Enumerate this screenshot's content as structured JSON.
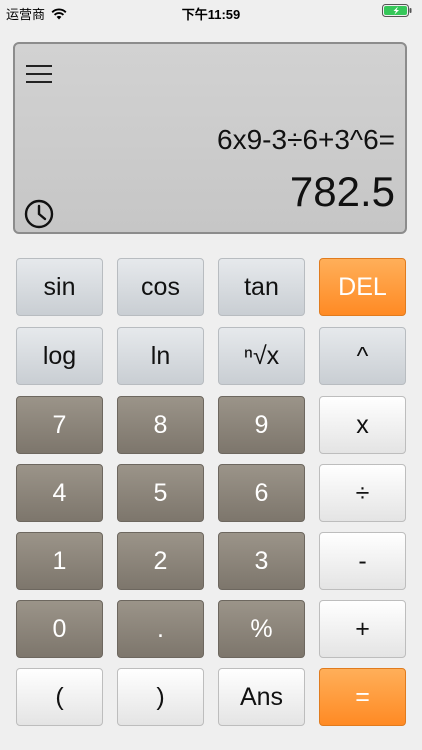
{
  "status_bar": {
    "carrier": "运营商",
    "time": "下午11:59"
  },
  "display": {
    "expression": "6x9-3÷6+3^6=",
    "result": "782.5"
  },
  "keys": {
    "sin": "sin",
    "cos": "cos",
    "tan": "tan",
    "del": "DEL",
    "log": "log",
    "ln": "ln",
    "nth_root": "ⁿ√x",
    "power": "^",
    "seven": "7",
    "eight": "8",
    "nine": "9",
    "multiply": "x",
    "four": "4",
    "five": "5",
    "six": "6",
    "divide": "÷",
    "one": "1",
    "two": "2",
    "three": "3",
    "minus": "-",
    "zero": "0",
    "decimal": ".",
    "percent": "%",
    "plus": "+",
    "open_paren": "(",
    "close_paren": ")",
    "ans": "Ans",
    "equals": "="
  },
  "colors": {
    "accent": "#ff8a24",
    "number_key": "#8c857b",
    "function_key": "#d6dadd",
    "display_bg": "#cbcbcb"
  },
  "icons": [
    "wifi-icon",
    "battery-icon",
    "menu-icon",
    "history-icon"
  ]
}
